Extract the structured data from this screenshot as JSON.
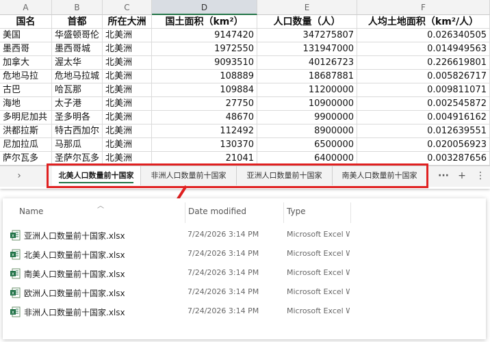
{
  "spreadsheet": {
    "column_letters": [
      "A",
      "B",
      "C",
      "D",
      "E",
      "F"
    ],
    "selected_column": "D",
    "headers": [
      "国名",
      "首都",
      "所在大洲",
      "国土面积（km²）",
      "人口数量（人）",
      "人均土地面积（km²/人）"
    ],
    "rows": [
      [
        "美国",
        "华盛顿哥伦",
        "北美洲",
        "9147420",
        "347275807",
        "0.026340505"
      ],
      [
        "墨西哥",
        "墨西哥城",
        "北美洲",
        "1972550",
        "131947000",
        "0.014949563"
      ],
      [
        "加拿大",
        "渥太华",
        "北美洲",
        "9093510",
        "40126723",
        "0.226619801"
      ],
      [
        "危地马拉",
        "危地马拉城",
        "北美洲",
        "108889",
        "18687881",
        "0.005826717"
      ],
      [
        "古巴",
        "哈瓦那",
        "北美洲",
        "109884",
        "11200000",
        "0.009811071"
      ],
      [
        "海地",
        "太子港",
        "北美洲",
        "27750",
        "10900000",
        "0.002545872"
      ],
      [
        "多明尼加共",
        "圣多明各",
        "北美洲",
        "48670",
        "9900000",
        "0.004916162"
      ],
      [
        "洪都拉斯",
        "特古西加尔",
        "北美洲",
        "112492",
        "8900000",
        "0.012639551"
      ],
      [
        "尼加拉瓜",
        "马那瓜",
        "北美洲",
        "130370",
        "6500000",
        "0.020056923"
      ],
      [
        "萨尔瓦多",
        "圣萨尔瓦多",
        "北美洲",
        "21041",
        "6400000",
        "0.003287656"
      ]
    ],
    "tabs": [
      "北美人口数量前十国家",
      "非洲人口数量前十国家",
      "亚洲人口数量前十国家",
      "南美人口数量前十国家"
    ],
    "active_tab_index": 0,
    "nav_left_icon": "chevron-right-icon",
    "more_icon": "ellipsis-icon",
    "add_sheet_icon": "plus-icon",
    "options_icon": "vertical-dots-icon",
    "highlight_color": "#e02020",
    "accent_color": "#217346"
  },
  "explorer": {
    "columns": {
      "name": "Name",
      "date": "Date modified",
      "type": "Type"
    },
    "files": [
      {
        "name": "亚洲人口数量前十国家.xlsx",
        "date": "7/24/2026 3:14 PM",
        "type": "Microsoft Excel W"
      },
      {
        "name": "北美人口数量前十国家.xlsx",
        "date": "7/24/2026 3:14 PM",
        "type": "Microsoft Excel W"
      },
      {
        "name": "南美人口数量前十国家.xlsx",
        "date": "7/24/2026 3:14 PM",
        "type": "Microsoft Excel W"
      },
      {
        "name": "欧洲人口数量前十国家.xlsx",
        "date": "7/24/2026 3:14 PM",
        "type": "Microsoft Excel W"
      },
      {
        "name": "非洲人口数量前十国家.xlsx",
        "date": "7/24/2026 3:14 PM",
        "type": "Microsoft Excel W"
      }
    ],
    "file_icon": "excel-file-icon"
  }
}
